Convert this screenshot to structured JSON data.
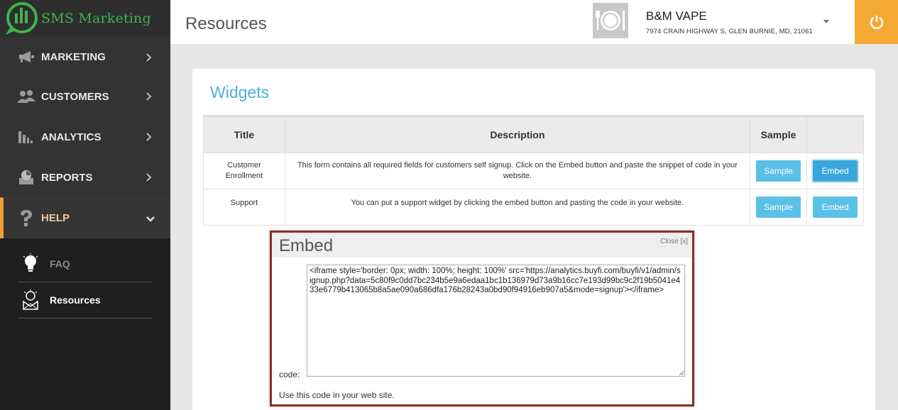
{
  "app": {
    "logo_text": "SMS Marketing"
  },
  "sidebar": {
    "items": [
      {
        "label": "MARKETING",
        "icon": "megaphone-icon"
      },
      {
        "label": "CUSTOMERS",
        "icon": "users-icon"
      },
      {
        "label": "ANALYTICS",
        "icon": "bar-chart-icon"
      },
      {
        "label": "REPORTS",
        "icon": "report-icon"
      },
      {
        "label": "HELP",
        "icon": "question-icon"
      }
    ],
    "subitems": [
      {
        "label": "FAQ",
        "icon": "lightbulb-icon"
      },
      {
        "label": "Resources",
        "icon": "resources-icon"
      }
    ]
  },
  "header": {
    "title": "Resources",
    "store_name": "B&M VAPE",
    "store_address": "7974 CRAIN HIGHWAY S, GLEN BURNIE, MD, 21061"
  },
  "widgets": {
    "title": "Widgets",
    "columns": [
      "Title",
      "Description",
      "Sample",
      ""
    ],
    "rows": [
      {
        "title": "Customer Enrollment",
        "description": "This form contains all required fields for customers self signup. Click on the Embed button and paste the snippet of code in your website.",
        "sample_label": "Sample",
        "embed_label": "Embed"
      },
      {
        "title": "Support",
        "description": "You can put a support widget by clicking the embed button and pasting the code in your website.",
        "sample_label": "Sample",
        "embed_label": "Embed"
      }
    ]
  },
  "embed_dialog": {
    "title": "Embed",
    "close_label": "Close [x]",
    "code_label": "code:",
    "code": "<iframe style='border: 0px; width: 100%; height: 100%' src='https://analytics.buyfi.com/buyfi/v1/admin/signup.php?data=5c80f9c0dd7bc234b5e9a6edaa1bc1b136979d73a9b16cc7e193d99bc9c2f19b5041e433e6779b413065b8a5ae090a686dfa176b28243a0bd90f94916eb907a5&mode=signup'></iframe>",
    "note": "Use this code in your web site."
  },
  "colors": {
    "accent": "#f4a934",
    "brand": "#3fb34f",
    "link": "#4aaedc",
    "button": "#5bc0e6",
    "dialog_border": "#8b2c2c"
  }
}
